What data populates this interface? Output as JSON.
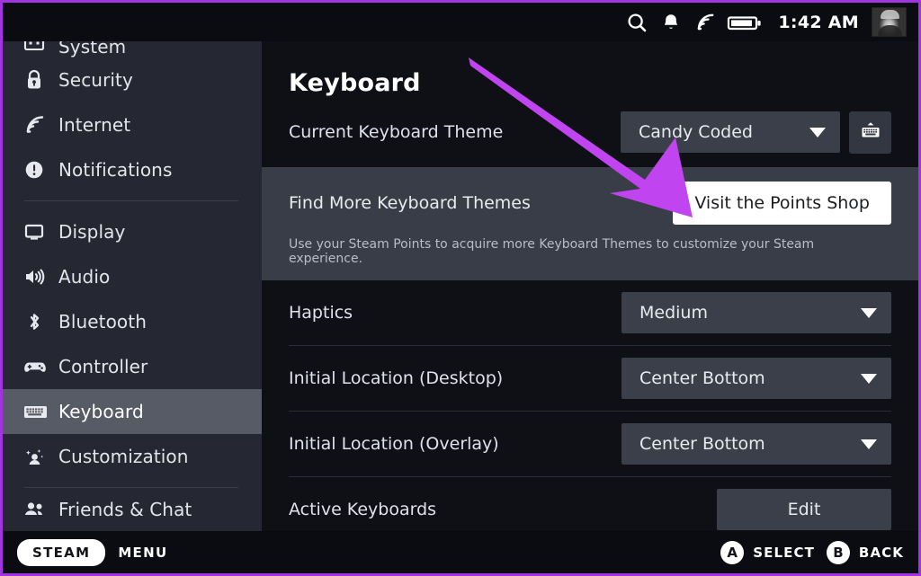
{
  "statusbar": {
    "icons": [
      "search-icon",
      "bell-icon",
      "wifi-icon",
      "battery-icon"
    ],
    "time": "1:42 AM",
    "avatar_label": "avatar"
  },
  "sidebar": {
    "items": [
      {
        "label": "System",
        "icon": "system-icon",
        "active": false,
        "partial": true,
        "separator_after": false
      },
      {
        "label": "Security",
        "icon": "lock-icon",
        "active": false,
        "partial": false,
        "separator_after": false
      },
      {
        "label": "Internet",
        "icon": "wifi-icon",
        "active": false,
        "partial": false,
        "separator_after": false
      },
      {
        "label": "Notifications",
        "icon": "notification-icon",
        "active": false,
        "partial": false,
        "separator_after": true
      },
      {
        "label": "Display",
        "icon": "monitor-icon",
        "active": false,
        "partial": false,
        "separator_after": false
      },
      {
        "label": "Audio",
        "icon": "speaker-icon",
        "active": false,
        "partial": false,
        "separator_after": false
      },
      {
        "label": "Bluetooth",
        "icon": "bluetooth-icon",
        "active": false,
        "partial": false,
        "separator_after": false
      },
      {
        "label": "Controller",
        "icon": "gamepad-icon",
        "active": false,
        "partial": false,
        "separator_after": false
      },
      {
        "label": "Keyboard",
        "icon": "keyboard-icon",
        "active": true,
        "partial": false,
        "separator_after": false
      },
      {
        "label": "Customization",
        "icon": "sparkle-person-icon",
        "active": false,
        "partial": false,
        "separator_after": true
      },
      {
        "label": "Friends & Chat",
        "icon": "friends-icon",
        "active": false,
        "partial": true,
        "separator_after": false
      }
    ]
  },
  "main": {
    "title": "Keyboard",
    "theme_row": {
      "label": "Current Keyboard Theme",
      "value": "Candy Coded",
      "preview_icon": "keyboard-preview-icon"
    },
    "points_block": {
      "label": "Find More Keyboard Themes",
      "button": "Visit the Points Shop",
      "description": "Use your Steam Points to acquire more Keyboard Themes to customize your Steam experience."
    },
    "settings": [
      {
        "label": "Haptics",
        "value": "Medium",
        "control": "dropdown"
      },
      {
        "label": "Initial Location (Desktop)",
        "value": "Center Bottom",
        "control": "dropdown"
      },
      {
        "label": "Initial Location (Overlay)",
        "value": "Center Bottom",
        "control": "dropdown"
      },
      {
        "label": "Active Keyboards",
        "value": "Edit",
        "control": "button"
      }
    ]
  },
  "bottombar": {
    "steam_label": "STEAM",
    "menu_label": "MENU",
    "hints": [
      {
        "key": "A",
        "label": "SELECT"
      },
      {
        "key": "B",
        "label": "BACK"
      }
    ]
  },
  "annotation": {
    "color": "#c044f0",
    "frame_color": "#a233e0",
    "type": "arrow"
  }
}
